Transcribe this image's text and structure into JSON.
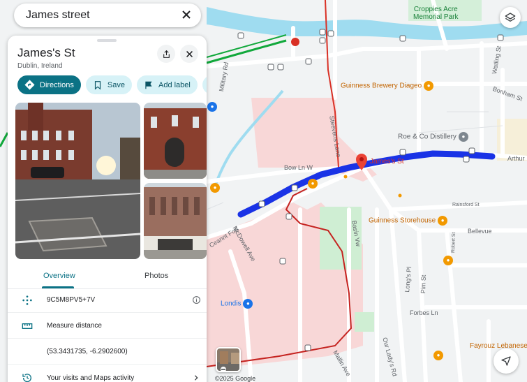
{
  "search": {
    "query": "James street"
  },
  "place": {
    "name": "James's St",
    "locality": "Dublin, Ireland",
    "actions": [
      {
        "label": "Directions",
        "icon": "directions-icon"
      },
      {
        "label": "Save",
        "icon": "bookmark-icon"
      },
      {
        "label": "Add label",
        "icon": "flag-icon"
      }
    ]
  },
  "tabs": {
    "overview": "Overview",
    "photos": "Photos"
  },
  "details": {
    "plus_code": "9C5M8PV5+7V",
    "measure": "Measure distance",
    "coordinates": "(53.3431735, -6.2902600)",
    "visits": "Your visits and Maps activity"
  },
  "map": {
    "copyright": "©2025 Google",
    "pois": {
      "croppies": "Croppies Acre\nMemorial Park",
      "guinness_diageo": "Guinness Brewery Diageo",
      "roe": "Roe & Co Distillery",
      "guinness_storehouse": "Guinness Storehouse",
      "londis": "Londis",
      "fayrouz": "Fayrouz Lebanese"
    },
    "streets": {
      "james": "James's St",
      "bow_ln": "Bow Ln W",
      "military": "Military Rd",
      "steevens": "Steevens Lane",
      "bonham": "Bonham St",
      "watling": "Watling St",
      "arthur": "Arthur",
      "rainsford": "Rainsford St",
      "bellevue": "Bellevue",
      "basin": "Basin Vw",
      "mcdowell": "McDowell Ave",
      "ceannt": "Ceannt Fort",
      "longs": "Long's Pl",
      "pim": "Pim St",
      "robert": "Robert St",
      "forbes": "Forbes Ln",
      "ourladys": "Our Lady's Rd",
      "mallin": "Mallin Ave"
    }
  },
  "colors": {
    "accent": "#0b7285",
    "route": "#1a33e6",
    "pin": "#ea4335",
    "water": "#9fdcf0",
    "hospital_zone": "#f8d7d7"
  }
}
